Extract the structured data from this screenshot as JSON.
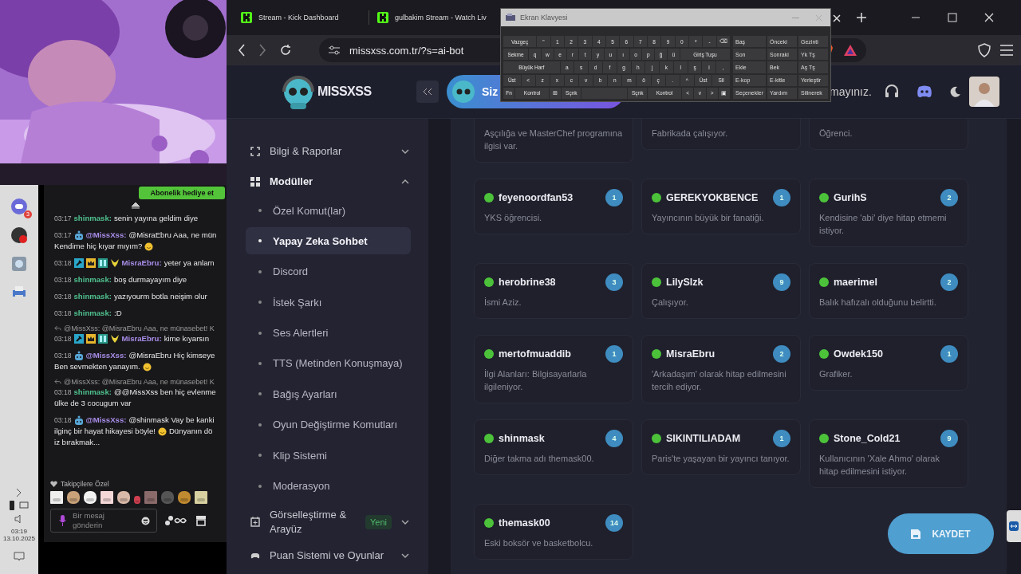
{
  "taskbar": {
    "discord_badge": "3",
    "clock_time": "03:19",
    "clock_date": "13.10.2025"
  },
  "chat": {
    "gift_button": "Abonelik hediye et",
    "messages": [
      {
        "time": "03:17",
        "bot": false,
        "user": "shinmask:",
        "color": "#4fc08d",
        "lines": [
          [
            {
              "text": "senin yayına geldim diye"
            }
          ]
        ]
      },
      {
        "time": "03:17",
        "bot": true,
        "user": "@MissXss:",
        "color": "#a98de8",
        "lines": [
          [
            {
              "text": "@MisraEbru Aaa, ne mün"
            }
          ],
          [
            {
              "text": "Kendime hiç kıyar mıyım?"
            },
            {
              "kind": "emoji"
            }
          ]
        ]
      },
      {
        "time": "03:18",
        "bot": false,
        "badges": [
          {
            "kind": "hammer"
          },
          {
            "kind": "crown"
          },
          {
            "kind": "grid"
          },
          {
            "kind": "pika"
          }
        ],
        "user": "MisraEbru:",
        "color": "#a98de8",
        "lines": [
          [
            {
              "text": "yeter ya anlam"
            }
          ]
        ]
      },
      {
        "time": "03:18",
        "bot": false,
        "user": "shinmask:",
        "color": "#4fc08d",
        "lines": [
          [
            {
              "text": "boş durmayayım diye"
            }
          ]
        ]
      },
      {
        "time": "03:18",
        "bot": false,
        "user": "shinmask:",
        "color": "#4fc08d",
        "lines": [
          [
            {
              "text": "yazıyourm botla neişim olur"
            }
          ]
        ]
      },
      {
        "time": "03:18",
        "bot": false,
        "user": "shinmask:",
        "color": "#4fc08d",
        "lines": [
          [
            {
              "text": ":D"
            }
          ]
        ]
      },
      {
        "reply": "@MissXss: @MisraEbru Aaa, ne münasebet! K",
        "time": "03:18",
        "bot": false,
        "badges": [
          {
            "kind": "hammer"
          },
          {
            "kind": "crown"
          },
          {
            "kind": "grid"
          },
          {
            "kind": "pika"
          }
        ],
        "user": "MisraEbru:",
        "color": "#a98de8",
        "lines": [
          [
            {
              "text": "kime kıyarsın"
            }
          ]
        ]
      },
      {
        "time": "03:18",
        "bot": true,
        "user": "@MissXss:",
        "color": "#a98de8",
        "lines": [
          [
            {
              "text": "@MisraEbru Hiç kimseye"
            }
          ],
          [
            {
              "text": "Ben sevmekten yanayım."
            },
            {
              "kind": "emoji"
            }
          ]
        ]
      },
      {
        "reply": "@MissXss: @MisraEbru Aaa, ne münasebet! K",
        "time": "03:18",
        "bot": false,
        "user": "shinmask:",
        "color": "#4fc08d",
        "lines": [
          [
            {
              "text": "@@MissXss ben hiç evlenme"
            }
          ],
          [
            {
              "text": "ülke de 3 cocugum var"
            }
          ]
        ]
      },
      {
        "time": "03:18",
        "bot": true,
        "user": "@MissXss:",
        "color": "#a98de8",
        "lines": [
          [
            {
              "text": "@shinmask Vay be kanki"
            }
          ],
          [
            {
              "text": "ilginç bir hayat hikayesi böyle!"
            },
            {
              "kind": "emoji"
            },
            {
              "text": "Dünyanın dö"
            }
          ],
          [
            {
              "text": "iz bırakmak..."
            }
          ]
        ]
      }
    ],
    "emotes_label": "Takipçilere Özel",
    "input": {
      "placeholder": "Bir mesaj gönderin"
    }
  },
  "browser": {
    "tabs": [
      {
        "title": "Stream - Kick Dashboard",
        "selected": false
      },
      {
        "title": "gulbakim Stream - Watch Liv",
        "selected": false
      }
    ],
    "url": "missxss.com.tr/?s=ai-bot"
  },
  "keyboard": {
    "title": "Ekran Klavyesi",
    "rows": [
      {
        "keys": [
          "Vazgeç",
          "\"",
          "1",
          "2",
          "3",
          "4",
          "5",
          "6",
          "7",
          "8",
          "9",
          "0",
          "*",
          "-",
          "⌫"
        ]
      },
      {
        "keys": [
          "Sekme",
          "q",
          "w",
          "e",
          "r",
          "t",
          "y",
          "u",
          "ı",
          "o",
          "p",
          "ğ",
          "ü",
          "Giriş Tuşu"
        ]
      },
      {
        "keys": [
          "Büyük Harf",
          "a",
          "s",
          "d",
          "f",
          "g",
          "h",
          "j",
          "k",
          "l",
          "ş",
          "i",
          ","
        ]
      },
      {
        "keys": [
          "Üst",
          "<",
          "z",
          "x",
          "c",
          "v",
          "b",
          "n",
          "m",
          "ö",
          "ç",
          ".",
          "^",
          "Üst",
          "Sil"
        ]
      },
      {
        "kind": "bottom",
        "keys": [
          "Fn",
          "Kontrol",
          "⊞",
          "Sçnk",
          "Sçnk",
          "Kontrol",
          "<",
          "v",
          ">",
          "▣"
        ]
      }
    ],
    "nav": [
      "Baş",
      "Önceki",
      "Gezinti",
      "Son",
      "Sonraki",
      "Yk Tş",
      "Ekle",
      "Bek",
      "Aş Tş",
      "E-kop",
      "E-kitle",
      "Yerleştir",
      "Seçenekler",
      "Yardım",
      "Silinerek"
    ]
  },
  "header": {
    "logo": "MISSXSS",
    "banner": "Siz",
    "notice": "mayınız."
  },
  "sidebar": {
    "items": [
      {
        "label": "Bilgi & Raporlar",
        "expanded": false
      },
      {
        "label": "Modüller",
        "expanded": true,
        "children": [
          {
            "label": "Özel Komut(lar)",
            "selected": false
          },
          {
            "label": "Yapay Zeka Sohbet",
            "selected": true
          },
          {
            "label": "Discord",
            "selected": false
          },
          {
            "label": "İstek Şarkı",
            "selected": false
          },
          {
            "label": "Ses Alertleri",
            "selected": false
          },
          {
            "label": "TTS (Metinden Konuşmaya)",
            "selected": false
          },
          {
            "label": "Bağış Ayarları",
            "selected": false
          },
          {
            "label": "Oyun Değiştirme Komutları",
            "selected": false
          },
          {
            "label": "Klip Sistemi",
            "selected": false
          },
          {
            "label": "Moderasyon",
            "selected": false
          }
        ]
      },
      {
        "label": "Görselleştirme & Arayüz",
        "badge": "Yeni",
        "expanded": false
      },
      {
        "label": "Puan Sistemi ve Oyunlar",
        "expanded": false
      }
    ]
  },
  "cards_partial": [
    "Aşçılığa ve MasterChef programına ilgisi var.",
    "Fabrikada çalışıyor.",
    "Öğrenci."
  ],
  "cards": [
    {
      "name": "feyenoordfan53",
      "count": "1",
      "online": true,
      "note": "YKS öğrencisi."
    },
    {
      "name": "GEREKYOKBENCE",
      "count": "1",
      "online": true,
      "note": "Yayıncının büyük bir fanatiği."
    },
    {
      "name": "GurihS",
      "count": "2",
      "online": true,
      "note": "Kendisine 'abi' diye hitap etmemi istiyor."
    },
    {
      "name": "herobrine38",
      "count": "3",
      "online": true,
      "note": "İsmi Aziz."
    },
    {
      "name": "LilySlzk",
      "count": "9",
      "online": true,
      "note": "Çalışıyor."
    },
    {
      "name": "maerimel",
      "count": "2",
      "online": true,
      "note": "Balık hafızalı olduğunu belirtti."
    },
    {
      "name": "mertofmuaddib",
      "count": "1",
      "online": true,
      "note": "İlgi Alanları: Bilgisayarlarla ilgileniyor."
    },
    {
      "name": "MisraEbru",
      "count": "2",
      "online": true,
      "note": "'Arkadaşım' olarak hitap edilmesini tercih ediyor."
    },
    {
      "name": "Owdek150",
      "count": "1",
      "online": true,
      "note": "Grafiker."
    },
    {
      "name": "shinmask",
      "count": "4",
      "online": true,
      "note": "Diğer takma adı themask00."
    },
    {
      "name": "SIKINTILIADAM",
      "count": "1",
      "online": true,
      "note": "Paris'te yaşayan bir yayıncı tanıyor."
    },
    {
      "name": "Stone_Cold21",
      "count": "9",
      "online": true,
      "note": "Kullanıcının 'Xale Ahmo' olarak hitap edilmesini istiyor."
    },
    {
      "name": "themask00",
      "count": "14",
      "online": true,
      "note": "Eski boksör ve basketbolcu."
    }
  ],
  "save_button": "KAYDET"
}
